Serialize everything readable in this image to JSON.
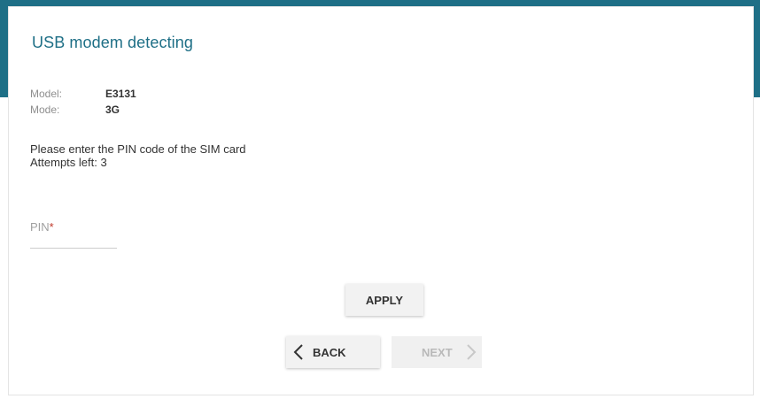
{
  "title": "USB modem detecting",
  "info": {
    "model_label": "Model:",
    "model_value": "E3131",
    "mode_label": "Mode:",
    "mode_value": "3G"
  },
  "message": {
    "line1": "Please enter the PIN code of the SIM card",
    "line2": "Attempts left: 3"
  },
  "pin": {
    "label": "PIN",
    "required_mark": "*",
    "value": "",
    "placeholder": ""
  },
  "buttons": {
    "apply": "APPLY",
    "back": "BACK",
    "next": "NEXT"
  },
  "colors": {
    "accent": "#1e6f86",
    "required": "#c0392b"
  },
  "icons": {
    "back": "chevron-left-icon",
    "next": "chevron-right-icon"
  }
}
